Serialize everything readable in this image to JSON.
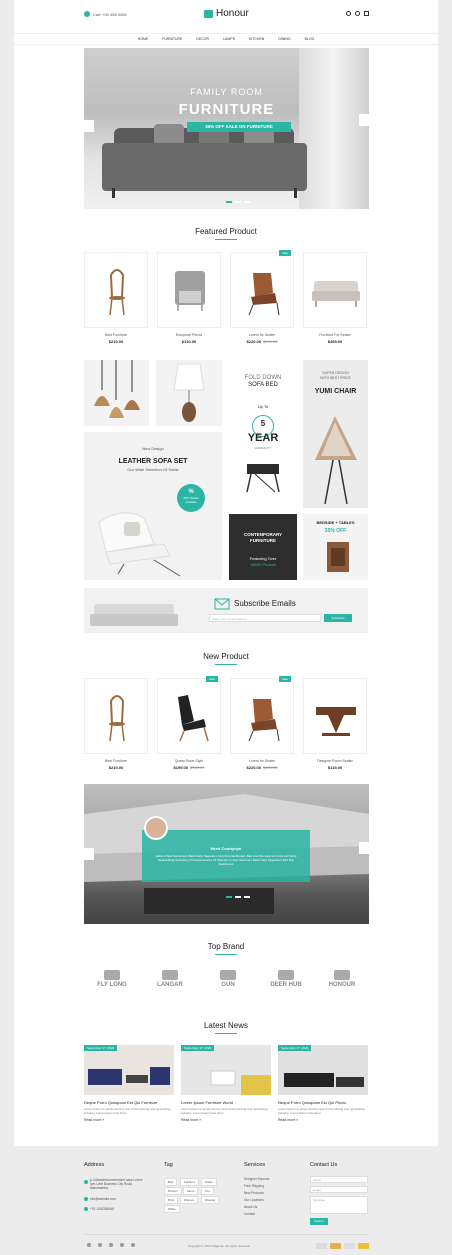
{
  "header": {
    "phone": "Call: +00 456 4455",
    "logo": "Honour",
    "nav": [
      "Home",
      "Furniture",
      "Decor",
      "Lamps",
      "Kitchen",
      "Dining",
      "Blog"
    ]
  },
  "hero": {
    "line1": "FAMILY ROOM",
    "line2": "FURNITURE",
    "pill": "35% OFF SALE ON FURNITURE"
  },
  "featured": {
    "title": "Featured Product",
    "products": [
      {
        "name": "Best Furniture",
        "price": "$210.00",
        "old": ""
      },
      {
        "name": "European Period",
        "price": "$120.00",
        "old": ""
      },
      {
        "name": "Lorem for Seater",
        "price": "$220.00",
        "old": "$450.00",
        "badge": "Sale"
      },
      {
        "name": "Furniture For Seater",
        "price": "$499.00",
        "old": ""
      }
    ]
  },
  "banners": {
    "fold": {
      "l1": "FOLD DOWN",
      "l2": "SOFA BED",
      "l3": "Up To",
      "l4": "5",
      "l5": "YEAR",
      "l6": "WARRANTY"
    },
    "yumi": {
      "l1": "SUPER DESIGN",
      "l2": "WITH BEST PRICE",
      "l3": "YUMI CHAIR"
    },
    "leather": {
      "l1": "New Design",
      "l2": "LEATHER SOFA SET",
      "l3": "Our Wide Selection Of Sofas",
      "b1": "%",
      "b2": "35% Visitors Available"
    },
    "contemporary": {
      "l1": "CONTENPORARY",
      "l2": "FURNITURE",
      "l3": "Featuring Over",
      "l4": "16500 Product"
    },
    "bedside": {
      "l1": "BEDSIDE + TABLES",
      "l2": "35% OFF"
    }
  },
  "subscribe": {
    "title": "Subscribe Emails",
    "placeholder": "Enter Your Email Address",
    "button": "Subscribe"
  },
  "newproduct": {
    "title": "New Product",
    "products": [
      {
        "name": "Best Furniture",
        "price": "$210.00",
        "old": ""
      },
      {
        "name": "Queen Bone Style",
        "price": "$199.00",
        "old": "$330.00",
        "badge": "Sale"
      },
      {
        "name": "Lorem for Seater",
        "price": "$220.00",
        "old": "$450.00",
        "badge": "Sale"
      },
      {
        "name": "Designer Room Seater",
        "price": "$119.00",
        "old": ""
      }
    ]
  },
  "testimonial": {
    "name": "Mred Courtyhyn",
    "quote": "Aaha in Spel Sarcentum Bash Daliy Sagadorm Dict Pos Dashboard. Bed one Ore Lano Am Into Lorcniture Spabarthing Sachnbery Pixasolk Enterre Of Sbandro In Ipse Sariturem Bash Daliy Sagadorm Dict Pos Dashboard."
  },
  "brands": {
    "title": "Top Brand",
    "items": [
      "FLY LONG",
      "LANGAR",
      "GUN",
      "DEER HUB",
      "HONOUR"
    ]
  },
  "news": {
    "title": "Latest News",
    "items": [
      {
        "date": "September 17, 2020",
        "title": "Deque Porro Quisquam Est Qui Furniture",
        "desc": "Lorem Ipsum is simply dummy text of the printing and typesetting industry. Lorem Ipsum has been",
        "more": "Read more »"
      },
      {
        "date": "September 17, 2020",
        "title": "Lorem Ipsum Furniture World",
        "desc": "Lorem Ipsum is simply dummy text of the printing and typesetting industry. Lorem Ipsum has been",
        "more": "Read more »"
      },
      {
        "date": "September 17, 2020",
        "title": "Neque Porro Quisquam Est Qui Photo",
        "desc": "Lorem Ipsum is simply dummy text of the printing and typesetting industry. Lorem Ipsum has been",
        "more": "Read more »"
      }
    ]
  },
  "footer": {
    "address_title": "Address",
    "address": "p-4 Maxdelcommenment says Lorem Ipm Limit Business City Road, Maharashtra",
    "email": "info@website.com",
    "phone": "+91 1002266445",
    "tag_title": "Tag",
    "tags": [
      "Bed",
      "Fashion",
      "Sofas",
      "Perfect",
      "Mens",
      "Top",
      "Print",
      "Women",
      "Wooder",
      "White"
    ],
    "services_title": "Services",
    "services": [
      "Designer Sources",
      "Free Shipping",
      "New Products",
      "Our Locations",
      "About Us",
      "Contact"
    ],
    "contact_title": "Contact Us",
    "contact_fields": [
      "Name",
      "Email",
      "Message"
    ],
    "submit": "Submit",
    "copyright": "Copyright © 2018 Magento. All rights reserved."
  }
}
